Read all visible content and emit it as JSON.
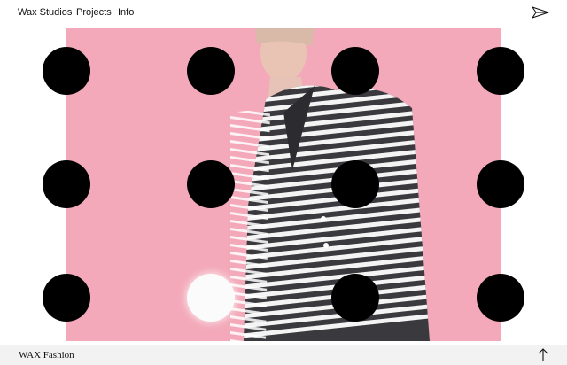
{
  "nav": {
    "brand": "Wax Studios",
    "links": [
      "Projects",
      "Info"
    ],
    "send_icon": "paper-plane-icon"
  },
  "hero": {
    "background_color": "#f3a9b9",
    "dot_color": "#000000",
    "highlight_dot_color": "#fbfbfb"
  },
  "footer": {
    "title": "WAX Fashion",
    "up_icon": "arrow-up-icon"
  }
}
